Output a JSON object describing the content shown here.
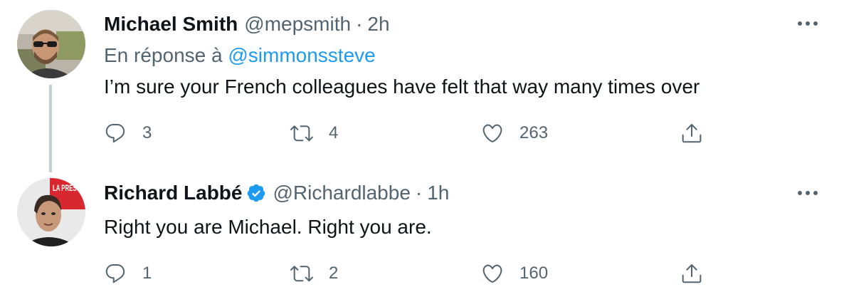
{
  "tweets": [
    {
      "name": "Michael Smith",
      "handle": "@mepsmith",
      "time": "2h",
      "reply_prefix": "En réponse à",
      "reply_handle": "@simmonssteve",
      "text": "I’m sure your French colleagues have felt that way many times over",
      "replies": "3",
      "retweets": "4",
      "likes": "263",
      "verified": false
    },
    {
      "name": "Richard Labbé",
      "handle": "@Richardlabbe",
      "time": "1h",
      "text": "Right you are Michael. Right you are.",
      "replies": "1",
      "retweets": "2",
      "likes": "160",
      "verified": true
    }
  ],
  "avatar_badge": "LA PRESSE",
  "separator": "·",
  "colors": {
    "link": "#1d9bf0",
    "muted": "#536471",
    "text": "#0f1419",
    "thread_line": "#c4cfd6"
  },
  "icons": {
    "reply": "reply-icon",
    "retweet": "retweet-icon",
    "like": "heart-icon",
    "share": "share-icon",
    "more": "more-icon",
    "verified": "verified-badge-icon"
  }
}
